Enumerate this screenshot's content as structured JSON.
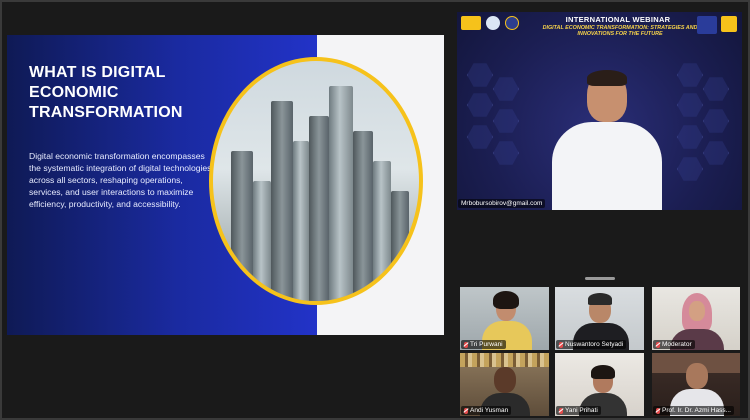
{
  "slide": {
    "heading": "WHAT IS DIGITAL ECONOMIC TRANSFORMATION",
    "body": "Digital economic transformation encompasses the systematic integration of digital technologies across all sectors, reshaping operations, services, and user interactions to maximize efficiency, productivity, and accessibility."
  },
  "speaker": {
    "banner_title": "INTERNATIONAL WEBINAR",
    "banner_subtitle": "DIGITAL ECONOMIC TRANSFORMATION: STRATEGIES AND INNOVATIONS FOR THE FUTURE",
    "name_tag": "Mrbobursobirov@gmail.com"
  },
  "participants": [
    {
      "name": "Tri Purwani"
    },
    {
      "name": "Nuswantoro Setyadi"
    },
    {
      "name": "Moderator"
    },
    {
      "name": "Andi Yusman"
    },
    {
      "name": "Yani Prihati"
    },
    {
      "name": "Prof. Ir. Dr. Azmi Hass..."
    }
  ],
  "colors": {
    "slide_blue": "#1a2aa0",
    "accent_yellow": "#f6c21b",
    "speaker_bg": "#1b1e52",
    "muted_mic": "#e34b4b"
  }
}
